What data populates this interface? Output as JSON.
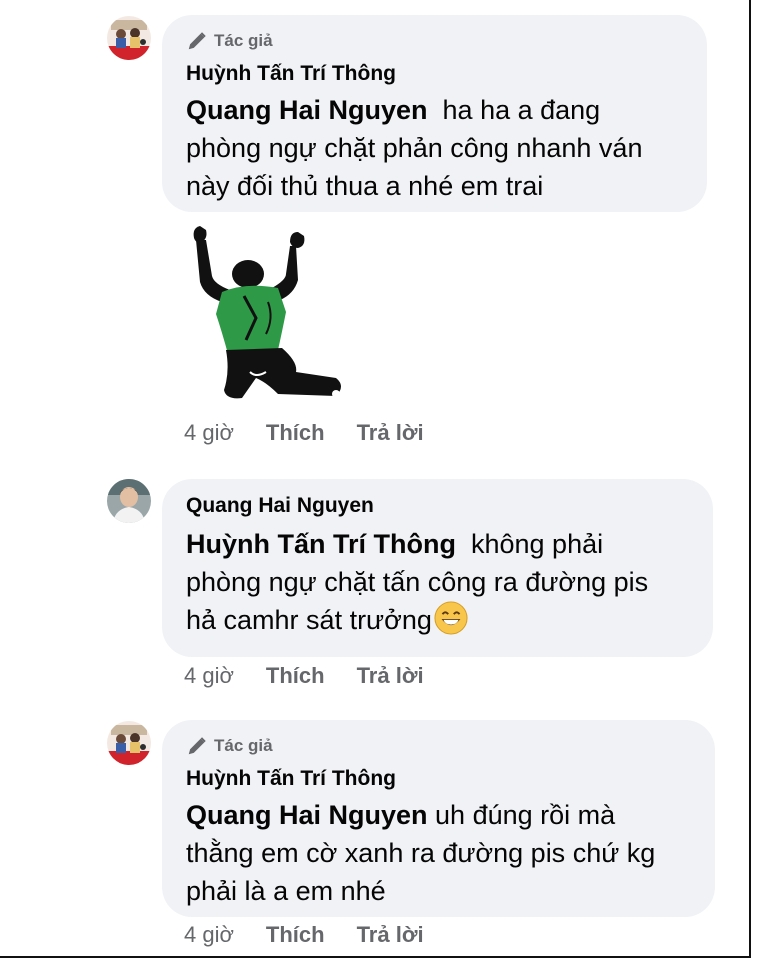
{
  "comments": [
    {
      "author_badge": "Tác giả",
      "name": "Huỳnh Tấn Trí Thông",
      "mention": "Quang Hai Nguyen",
      "line1_rest": "  ha ha a đang",
      "line2": "phòng ngự chặt phản công nhanh ván",
      "line3": "này đối thủ thua a nhé em trai",
      "time": "4 giờ",
      "like": "Thích",
      "reply": "Trả lời"
    },
    {
      "name": "Quang Hai Nguyen",
      "mention": "Huỳnh Tấn Trí Thông",
      "line1_rest": "  không phải",
      "line2": "phòng ngự chặt tấn công ra đường pis",
      "line3": "hả camhr sát trưởng",
      "time": "4 giờ",
      "like": "Thích",
      "reply": "Trả lời"
    },
    {
      "author_badge": "Tác giả",
      "name": "Huỳnh Tấn Trí Thông",
      "mention": "Quang Hai Nguyen",
      "line1_rest": " uh đúng rồi mà",
      "line2": "thằng em cờ xanh ra đường pis chứ kg",
      "line3": "phải là a em nhé",
      "time": "4 giờ",
      "like": "Thích",
      "reply": "Trả lời"
    }
  ],
  "icons": {
    "author_badge": "pencil-icon",
    "emoji": "grinning-face-emoji",
    "sticker": "celebrating-football-player-sticker"
  },
  "colors": {
    "bubble": "#f0f2f5",
    "meta_text": "#65676b",
    "text": "#050505",
    "sticker_shirt": "#2e9a47"
  }
}
